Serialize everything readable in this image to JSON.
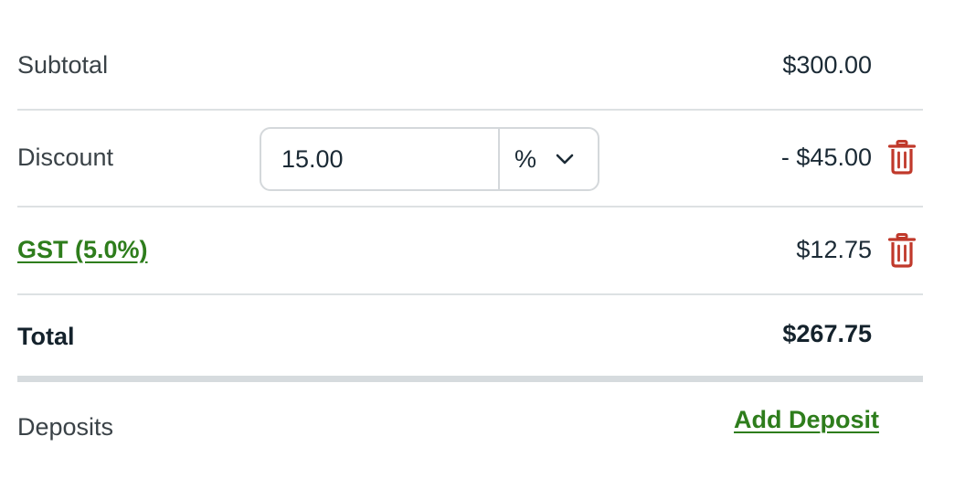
{
  "summary": {
    "subtotal": {
      "label": "Subtotal",
      "amount": "$300.00"
    },
    "discount": {
      "label": "Discount",
      "input_value": "15.00",
      "unit": "%",
      "amount": "- $45.00"
    },
    "tax": {
      "label": "GST (5.0%)",
      "amount": "$12.75"
    },
    "total": {
      "label": "Total",
      "amount": "$267.75"
    }
  },
  "deposits": {
    "label": "Deposits",
    "add_label": "Add Deposit"
  },
  "colors": {
    "link_green": "#2e7d1c",
    "delete_red": "#c0392b",
    "divider": "#dde1e3"
  },
  "icons": {
    "delete": "trash-icon",
    "dropdown": "chevron-down-icon"
  }
}
